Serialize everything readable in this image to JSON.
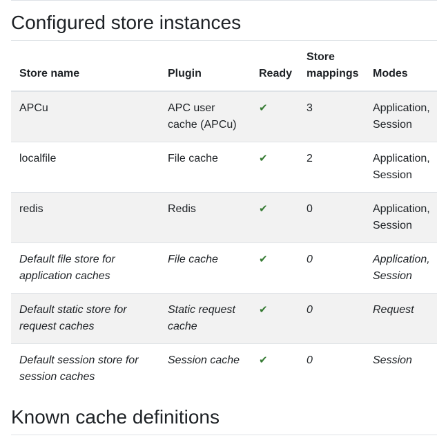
{
  "section_titles": {
    "configured": "Configured store instances",
    "known": "Known cache definitions"
  },
  "table": {
    "headers": {
      "store_name": "Store name",
      "plugin": "Plugin",
      "ready": "Ready",
      "store_mappings": "Store mappings",
      "modes": "Modes"
    },
    "rows": [
      {
        "store_name": "APCu",
        "plugin": "APC user cache (APCu)",
        "ready": true,
        "ready_icon": "check-icon",
        "mappings": "3",
        "modes": "Application, Session",
        "is_default": false
      },
      {
        "store_name": "localfile",
        "plugin": "File cache",
        "ready": true,
        "ready_icon": "check-icon",
        "mappings": "2",
        "modes": "Application, Session",
        "is_default": false
      },
      {
        "store_name": "redis",
        "plugin": "Redis",
        "ready": true,
        "ready_icon": "check-icon",
        "mappings": "0",
        "modes": "Application, Session",
        "is_default": false
      },
      {
        "store_name": "Default file store for application caches",
        "plugin": "File cache",
        "ready": true,
        "ready_icon": "check-icon",
        "mappings": "0",
        "modes": "Application, Session",
        "is_default": true
      },
      {
        "store_name": "Default static store for request caches",
        "plugin": "Static request cache",
        "ready": true,
        "ready_icon": "check-icon",
        "mappings": "0",
        "modes": "Request",
        "is_default": true
      },
      {
        "store_name": "Default session store for session caches",
        "plugin": "Session cache",
        "ready": true,
        "ready_icon": "check-icon",
        "mappings": "0",
        "modes": "Session",
        "is_default": true
      }
    ]
  },
  "colors": {
    "check": "#357a32",
    "stripe": "#f2f2f2",
    "border": "#dee2e6",
    "text": "#1d2125"
  }
}
